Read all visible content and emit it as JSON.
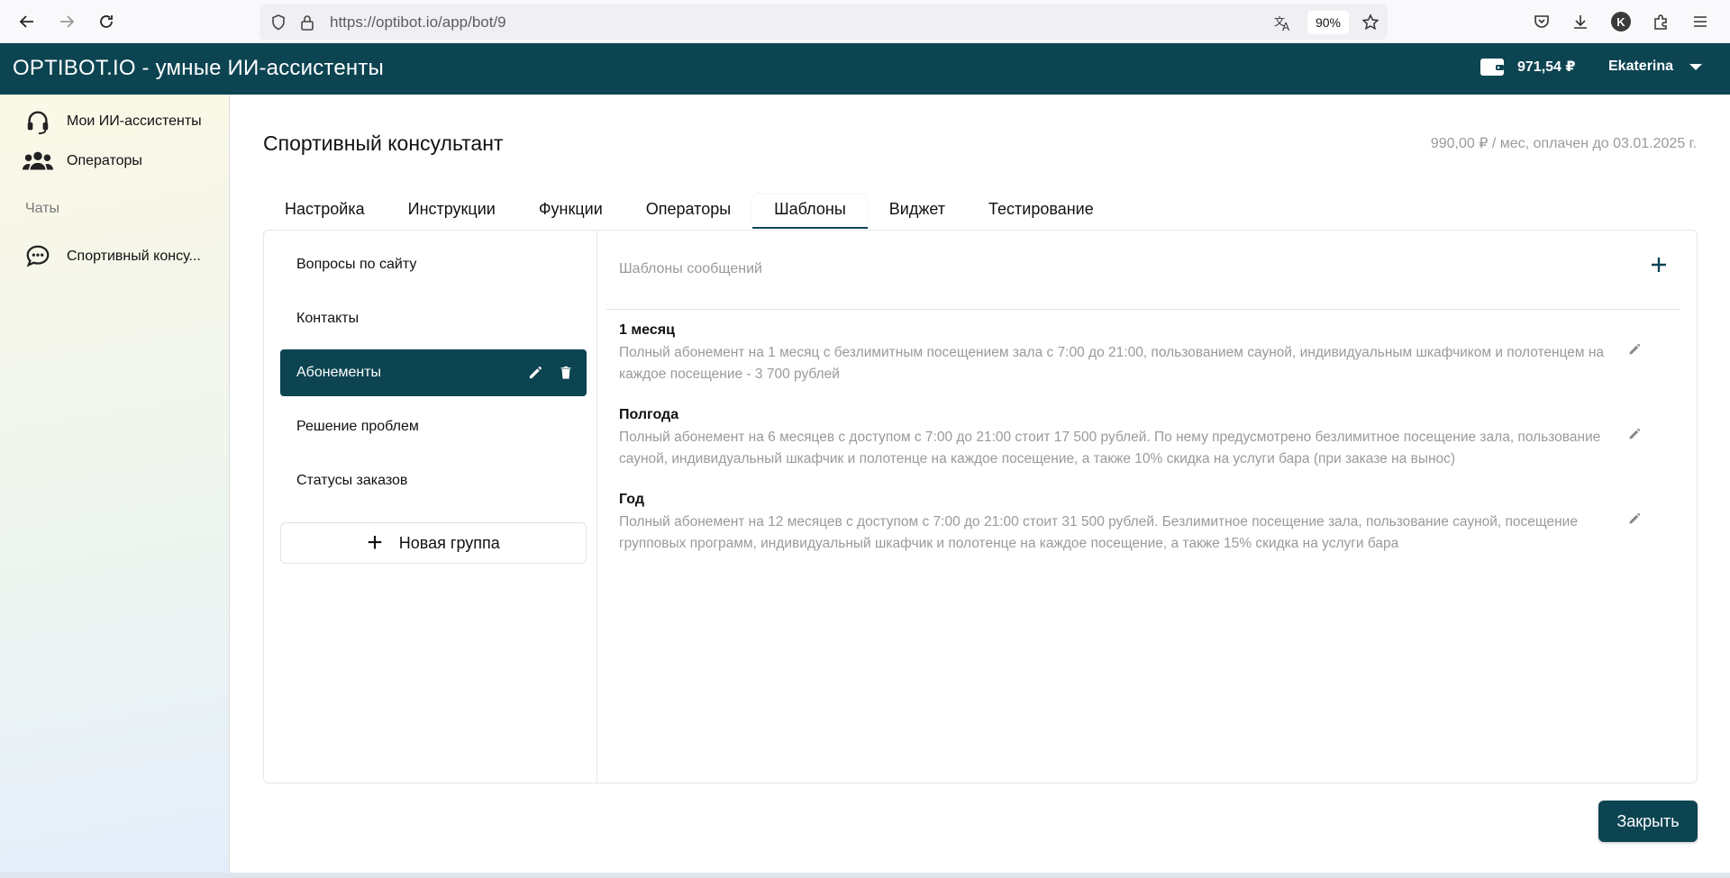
{
  "browser": {
    "url": "https://optibot.io/app/bot/9",
    "zoom": "90%",
    "profile_initial": "K"
  },
  "header": {
    "title": "OPTIBOT.IO - умные ИИ-ассистенты",
    "balance": "971,54 ₽",
    "user_name": "Ekaterina"
  },
  "sidebar": {
    "items": [
      {
        "label": "Мои ИИ-ассистенты",
        "icon": "headset-icon"
      },
      {
        "label": "Операторы",
        "icon": "users-icon"
      }
    ],
    "section_label": "Чаты",
    "chats": [
      {
        "label": "Спортивный консу...",
        "icon": "chat-bubble-icon"
      }
    ]
  },
  "main": {
    "title": "Спортивный консультант",
    "plan_info": "990,00 ₽ / мес, оплачен до 03.01.2025 г.",
    "tabs": [
      {
        "label": "Настройка",
        "active": false
      },
      {
        "label": "Инструкции",
        "active": false
      },
      {
        "label": "Функции",
        "active": false
      },
      {
        "label": "Операторы",
        "active": false
      },
      {
        "label": "Шаблоны",
        "active": true
      },
      {
        "label": "Виджет",
        "active": false
      },
      {
        "label": "Тестирование",
        "active": false
      }
    ],
    "groups": [
      {
        "label": "Вопросы по сайту",
        "active": false
      },
      {
        "label": "Контакты",
        "active": false
      },
      {
        "label": "Абонементы",
        "active": true
      },
      {
        "label": "Решение проблем",
        "active": false
      },
      {
        "label": "Статусы заказов",
        "active": false
      }
    ],
    "new_group_label": "Новая группа",
    "templates_header": "Шаблоны сообщений",
    "templates": [
      {
        "title": "1 месяц",
        "text": "Полный абонемент на 1 месяц с безлимитным посещением зала с 7:00 до 21:00, пользованием сауной, индивидуальным шкафчиком и полотенцем на каждое посещение - 3 700 рублей"
      },
      {
        "title": "Полгода",
        "text": "Полный абонемент на 6 месяцев с доступом с 7:00 до 21:00 стоит 17 500 рублей. По нему предусмотрено безлимитное посещение зала, пользование сауной, индивидуальный шкафчик и полотенце на каждое посещение, а также 10% скидка на услуги бара (при заказе на вынос)"
      },
      {
        "title": "Год",
        "text": "Полный абонемент на 12 месяцев с доступом с 7:00 до 21:00 стоит 31 500 рублей. Безлимитное посещение зала, пользование сауной, посещение групповых программ, индивидуальный шкафчик и полотенце на каждое посещение, а также 15% скидка на услуги бара"
      }
    ],
    "close_label": "Закрыть"
  },
  "colors": {
    "brand": "#0d4452",
    "muted_text": "#9a9a9a"
  }
}
